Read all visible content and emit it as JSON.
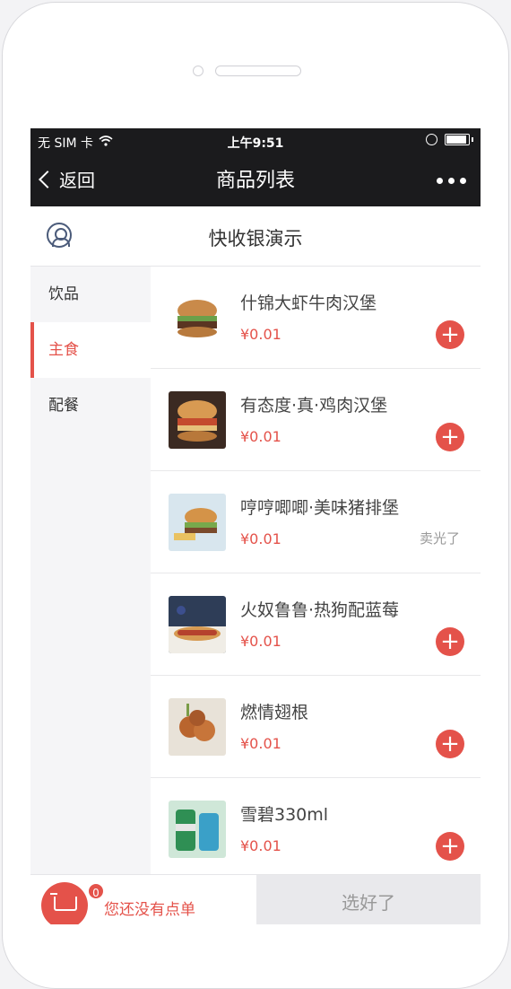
{
  "status_bar": {
    "carrier": "无 SIM 卡",
    "time": "上午9:51"
  },
  "nav": {
    "back_label": "返回",
    "title": "商品列表",
    "more_icon": "more-dots-icon"
  },
  "shop": {
    "name": "快收银演示",
    "icon": "user-circle-icon"
  },
  "categories": [
    {
      "label": "饮品",
      "active": false
    },
    {
      "label": "主食",
      "active": true
    },
    {
      "label": "配餐",
      "active": false
    }
  ],
  "products": [
    {
      "name": "什锦大虾牛肉汉堡",
      "price": "¥0.01",
      "status": "add"
    },
    {
      "name": "有态度·真·鸡肉汉堡",
      "price": "¥0.01",
      "status": "add"
    },
    {
      "name": "哼哼唧唧·美味猪排堡",
      "price": "¥0.01",
      "status": "卖光了"
    },
    {
      "name": "火奴鲁鲁·热狗配蓝莓",
      "price": "¥0.01",
      "status": "add"
    },
    {
      "name": "燃情翅根",
      "price": "¥0.01",
      "status": "add"
    },
    {
      "name": "雪碧330ml",
      "price": "¥0.01",
      "status": "add"
    }
  ],
  "cart": {
    "count": "0",
    "empty_text": "您还没有点单",
    "confirm_label": "选好了"
  },
  "colors": {
    "accent": "#e4524a",
    "navbar": "#1b1b1d"
  }
}
